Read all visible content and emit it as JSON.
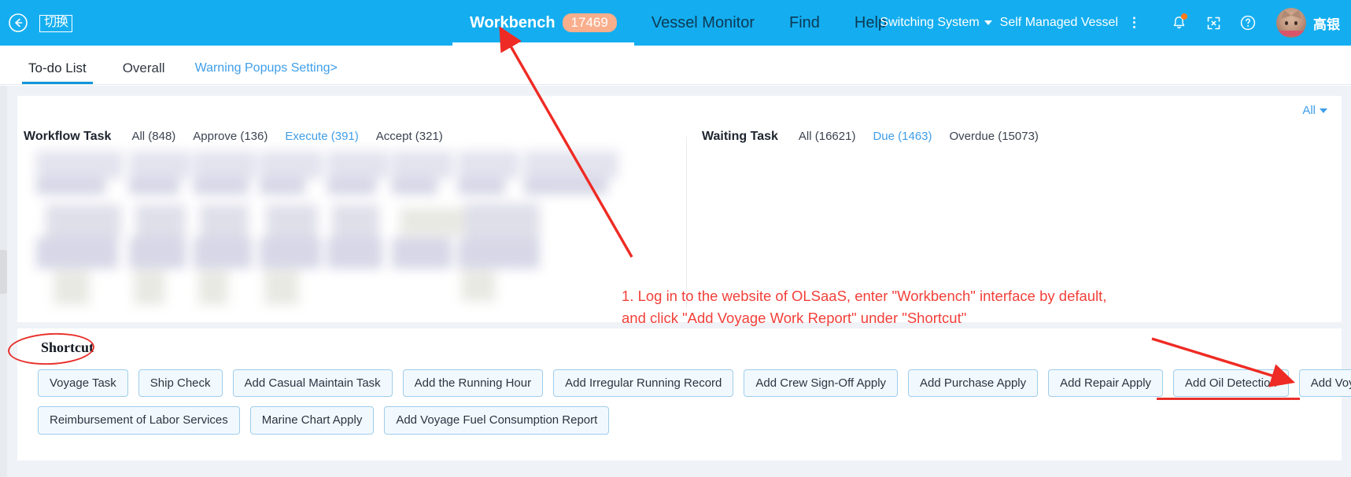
{
  "header": {
    "back_icon": "back-arrow-circle-icon",
    "switch_label": "切换",
    "nav": [
      {
        "label": "Workbench",
        "badge": "17469",
        "active": true
      },
      {
        "label": "Vessel Monitor",
        "badge": "",
        "active": false
      },
      {
        "label": "Find",
        "badge": "",
        "active": false
      },
      {
        "label": "Help",
        "badge": "",
        "active": false
      }
    ],
    "switching_system": "Switching System",
    "self_managed_vessel": "Self Managed Vessel",
    "icons": [
      "bell-icon",
      "fullscreen-icon",
      "help-circle-icon"
    ],
    "username": "高银",
    "bar_color": "#14AEF0",
    "badge_color": "#F9AE8C"
  },
  "tabs": {
    "items": [
      {
        "label": "To-do List",
        "active": true
      },
      {
        "label": "Overall",
        "active": false
      }
    ],
    "link": "Warning Popups Setting>"
  },
  "content": {
    "all_filter": "All",
    "workflow": {
      "title": "Workflow Task",
      "filters": [
        {
          "label": "All (848)",
          "active": false
        },
        {
          "label": "Approve (136)",
          "active": false
        },
        {
          "label": "Execute (391)",
          "active": true
        },
        {
          "label": "Accept (321)",
          "active": false
        }
      ]
    },
    "waiting": {
      "title": "Waiting Task",
      "filters": [
        {
          "label": "All (16621)",
          "active": false
        },
        {
          "label": "Due (1463)",
          "active": true
        },
        {
          "label": "Overdue (15073)",
          "active": false
        }
      ]
    }
  },
  "shortcut": {
    "title": "Shortcut",
    "rows": [
      [
        "Voyage Task",
        "Ship Check",
        "Add Casual Maintain Task",
        "Add the Running Hour",
        "Add Irregular Running Record",
        "Add Crew Sign-Off Apply",
        "Add Purchase Apply",
        "Add Repair Apply",
        "Add Oil Detection",
        "Add Voyage Work Report"
      ],
      [
        "Reimbursement of Labor Services",
        "Marine Chart Apply",
        "Add Voyage Fuel Consumption Report"
      ]
    ]
  },
  "annotation": {
    "text": "1. Log in to the website of OLSaaS, enter \"Workbench\" interface by default,\n    and click \"Add Voyage Work Report\" under \"Shortcut\"",
    "color": "#F2403A"
  }
}
